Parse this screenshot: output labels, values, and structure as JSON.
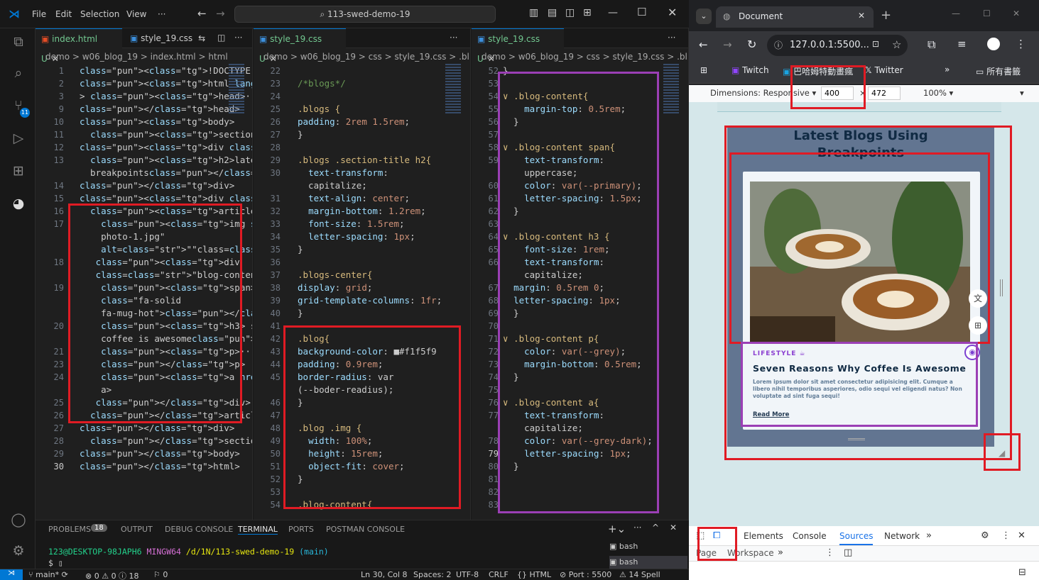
{
  "menu": {
    "items": [
      "File",
      "Edit",
      "Selection",
      "View",
      "···"
    ],
    "search": "113-swed-demo-19"
  },
  "editor1": {
    "tabs": [
      {
        "label": "index.html U",
        "icon": "html-icon"
      },
      {
        "label": "style_19.css",
        "icon": "css-icon"
      }
    ],
    "breadcrumb": "demo > w06_blog_19 > index.html > html",
    "lines": [
      {
        "n": "1",
        "t": "<!DOCTYPE html>"
      },
      {
        "n": "2",
        "t": "<html lang=\"en\">"
      },
      {
        "n": "3",
        "t": "> <head>···"
      },
      {
        "n": "9",
        "t": "</head>"
      },
      {
        "n": "10",
        "t": "<body>"
      },
      {
        "n": "11",
        "t": "  <section class=\"blogs\">"
      },
      {
        "n": "12",
        "t": "<div class=\"section-title\">"
      },
      {
        "n": "13",
        "t": "  <h2>latest blogs using"
      },
      {
        "n": "",
        "t": "  breakpoints</h2>"
      },
      {
        "n": "14",
        "t": "</div>"
      },
      {
        "n": "15",
        "t": "<div class=\"blogs-center\">"
      },
      {
        "n": "16",
        "t": "  <article class=\"blog\">"
      },
      {
        "n": "17",
        "t": "    <img src=\"./images/"
      },
      {
        "n": "",
        "t": "    photo-1.jpg\""
      },
      {
        "n": "",
        "t": "    alt=\"\"class=\"img\">"
      },
      {
        "n": "18",
        "t": "   <div"
      },
      {
        "n": "",
        "t": "   class=\"blog-content\">"
      },
      {
        "n": "19",
        "t": "    <span>lifestyle <i"
      },
      {
        "n": "",
        "t": "    class=\"fa-solid"
      },
      {
        "n": "",
        "t": "    fa-mug-hot\"></i></span>"
      },
      {
        "n": "20",
        "t": "    <h3> seven reasons why"
      },
      {
        "n": "",
        "t": "    coffee is awesome</h3>"
      },
      {
        "n": "21",
        "t": "    <p>···"
      },
      {
        "n": "23",
        "t": "    </p>"
      },
      {
        "n": "24",
        "t": "    <a href=\"#\">read more</"
      },
      {
        "n": "",
        "t": "    a>"
      },
      {
        "n": "25",
        "t": "   </div>"
      },
      {
        "n": "26",
        "t": "  </article>"
      },
      {
        "n": "27",
        "t": "</div>"
      },
      {
        "n": "28",
        "t": "  </section>"
      },
      {
        "n": "29",
        "t": "</body>"
      },
      {
        "n": "30",
        "t": "</html>"
      }
    ]
  },
  "editor2": {
    "tab": "style_19.css U",
    "breadcrumb": "demo > w06_blog_19 > css > style_19.css > .bl",
    "lines": [
      {
        "n": "22",
        "t": ""
      },
      {
        "n": "23",
        "t": "/*blogs*/"
      },
      {
        "n": "24",
        "t": ""
      },
      {
        "n": "25",
        "t": ".blogs {"
      },
      {
        "n": "26",
        "t": "padding: 2rem 1.5rem;"
      },
      {
        "n": "27",
        "t": "}"
      },
      {
        "n": "28",
        "t": ""
      },
      {
        "n": "29",
        "t": ".blogs .section-title h2{"
      },
      {
        "n": "30",
        "t": "  text-transform:"
      },
      {
        "n": "",
        "t": "  capitalize;"
      },
      {
        "n": "31",
        "t": "  text-align: center;"
      },
      {
        "n": "32",
        "t": "  margin-bottom: 1.2rem;"
      },
      {
        "n": "33",
        "t": "  font-size: 1.5rem;"
      },
      {
        "n": "34",
        "t": "  letter-spacing: 1px;"
      },
      {
        "n": "35",
        "t": "}"
      },
      {
        "n": "36",
        "t": ""
      },
      {
        "n": "37",
        "t": ".blogs-center{"
      },
      {
        "n": "38",
        "t": "display: grid;"
      },
      {
        "n": "39",
        "t": "grid-template-columns: 1fr;"
      },
      {
        "n": "40",
        "t": "}"
      },
      {
        "n": "41",
        "t": ""
      },
      {
        "n": "42",
        "t": ".blog{"
      },
      {
        "n": "43",
        "t": "background-color: ■#f1f5f9"
      },
      {
        "n": "44",
        "t": "padding: 0.9rem;"
      },
      {
        "n": "45",
        "t": "border-radius: var"
      },
      {
        "n": "",
        "t": "(--boder-readius);"
      },
      {
        "n": "46",
        "t": "}"
      },
      {
        "n": "47",
        "t": ""
      },
      {
        "n": "48",
        "t": ".blog .img {"
      },
      {
        "n": "49",
        "t": "  width: 100%;"
      },
      {
        "n": "50",
        "t": "  height: 15rem;"
      },
      {
        "n": "51",
        "t": "  object-fit: cover;"
      },
      {
        "n": "52",
        "t": "}"
      },
      {
        "n": "53",
        "t": ""
      },
      {
        "n": "54",
        "t": ".blog-content{"
      }
    ]
  },
  "editor3": {
    "tab": "style_19.css U",
    "breadcrumb": "demo > w06_blog_19 > css > style_19.css > .bl",
    "lines": [
      {
        "n": "52",
        "t": "}"
      },
      {
        "n": "53",
        "t": ""
      },
      {
        "n": "54",
        "t": "∨ .blog-content{"
      },
      {
        "n": "55",
        "t": "    margin-top: 0.5rem;"
      },
      {
        "n": "56",
        "t": "  }"
      },
      {
        "n": "57",
        "t": ""
      },
      {
        "n": "58",
        "t": "∨ .blog-content span{"
      },
      {
        "n": "59",
        "t": "    text-transform:"
      },
      {
        "n": "",
        "t": "    uppercase;"
      },
      {
        "n": "60",
        "t": "    color: var(--primary);"
      },
      {
        "n": "61",
        "t": "    letter-spacing: 1.5px;"
      },
      {
        "n": "62",
        "t": "  }"
      },
      {
        "n": "63",
        "t": ""
      },
      {
        "n": "64",
        "t": "∨ .blog-content h3 {"
      },
      {
        "n": "65",
        "t": "    font-size: 1rem;"
      },
      {
        "n": "66",
        "t": "    text-transform:"
      },
      {
        "n": "",
        "t": "    capitalize;"
      },
      {
        "n": "67",
        "t": "  margin: 0.5rem 0;"
      },
      {
        "n": "68",
        "t": "  letter-spacing: 1px;"
      },
      {
        "n": "69",
        "t": "  }"
      },
      {
        "n": "70",
        "t": ""
      },
      {
        "n": "71",
        "t": "∨ .blog-content p{"
      },
      {
        "n": "72",
        "t": "    color: var(--grey);"
      },
      {
        "n": "73",
        "t": "    margin-bottom: 0.5rem;"
      },
      {
        "n": "74",
        "t": "  }"
      },
      {
        "n": "75",
        "t": ""
      },
      {
        "n": "76",
        "t": "∨ .blog-content a{"
      },
      {
        "n": "77",
        "t": "    text-transform:"
      },
      {
        "n": "",
        "t": "    capitalize;"
      },
      {
        "n": "78",
        "t": "    color: var(--grey-dark);"
      },
      {
        "n": "79",
        "t": "    letter-spacing: 1px;"
      },
      {
        "n": "80",
        "t": "  }"
      },
      {
        "n": "81",
        "t": ""
      },
      {
        "n": "82",
        "t": ""
      },
      {
        "n": "83",
        "t": ""
      }
    ]
  },
  "panel": {
    "tabs": [
      "PROBLEMS",
      "OUTPUT",
      "DEBUG CONSOLE",
      "TERMINAL",
      "PORTS",
      "POSTMAN CONSOLE"
    ],
    "problems_count": "18",
    "prompt_user": "123@DESKTOP-98JAPH6",
    "prompt_env": "MINGW64",
    "prompt_path": "/d/1N/113-swed-demo-19",
    "prompt_branch": "(main)",
    "prompt_symbol": "$",
    "terminals": [
      "bash",
      "bash"
    ]
  },
  "statusbar": {
    "branch": "main*",
    "errors": "⊗ 0 ⚠ 0 ⓘ 18",
    "ports": "⚐ 0",
    "position": "Ln 30, Col 8",
    "spaces": "Spaces: 2",
    "encoding": "UTF-8",
    "eol": "CRLF",
    "lang": "{} HTML",
    "port": "⊘ Port : 5500",
    "spell": "⚠ 14 Spell"
  },
  "browser": {
    "tab_title": "Document",
    "url": "127.0.0.1:5500...",
    "bookmarks": [
      "Twitch",
      "巴哈姆特動畫瘋",
      "Twitter"
    ],
    "all_bookmarks": "所有書籤",
    "dimensions_label": "Dimensions: Responsive ▾",
    "width": "400",
    "height": "472",
    "zoom": "100% ▾",
    "page": {
      "heading_1": "Latest Blogs Using",
      "heading_2": "Breakpoints",
      "category": "LIFESTYLE ☕",
      "card_title": "Seven Reasons Why Coffee Is Awesome",
      "card_text": "Lorem ipsum dolor sit amet consectetur adipisicing elit. Cumque a libero nihil temporibus asperiores, odio sequi vel eligendi natus? Non voluptate ad sint fuga sequi!",
      "read_more": "Read More"
    },
    "devtools": {
      "tabs": [
        "Elements",
        "Console",
        "Sources",
        "Network"
      ],
      "active": "Sources",
      "subtabs": [
        "Page",
        "Workspace"
      ]
    }
  },
  "colors": {
    "accent": "#0078d4",
    "red_box": "#e01b24",
    "purple_box": "#9b3fb5",
    "swatch": "#f1f5f9"
  }
}
